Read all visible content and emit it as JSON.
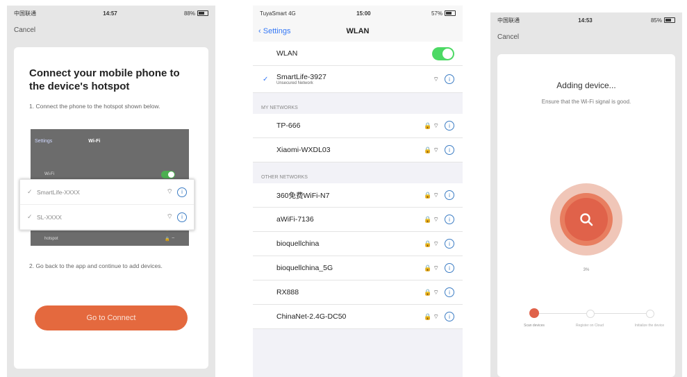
{
  "phone1": {
    "status": {
      "carrier": "中国联通",
      "time": "14:57",
      "battery": "88%"
    },
    "cancel": "Cancel",
    "title": "Connect your mobile phone to the device's hotspot",
    "step1": "1. Connect the phone to the hotspot shown below.",
    "mini": {
      "nav_back": "Settings",
      "nav_title": "Wi-Fi",
      "wifi_label": "Wi-Fi",
      "row_home": "home",
      "row_hotspot": "hotspot"
    },
    "networks": [
      "SmartLife-XXXX",
      "SL-XXXX"
    ],
    "step2": "2. Go back to the app and continue to add devices.",
    "button": "Go to Connect"
  },
  "phone2": {
    "status": {
      "carrier": "TuyaSmart",
      "signal": "4G",
      "time": "15:00",
      "battery": "57%"
    },
    "back": "Settings",
    "title": "WLAN",
    "wlan_label": "WLAN",
    "connected": {
      "name": "SmartLife-3927",
      "sub": "Unsecured Network"
    },
    "my_networks_header": "MY NETWORKS",
    "my_networks": [
      "TP-666",
      "Xiaomi-WXDL03"
    ],
    "other_networks_header": "OTHER NETWORKS",
    "other_networks": [
      "360免费WiFi-N7",
      "aWiFi-7136",
      "bioquellchina",
      "bioquellchina_5G",
      "RX888",
      "ChinaNet-2.4G-DC50"
    ]
  },
  "phone3": {
    "status": {
      "carrier": "中国联通",
      "time": "14:53",
      "battery": "85%"
    },
    "cancel": "Cancel",
    "title": "Adding device...",
    "hint": "Ensure that the Wi-Fi signal is good.",
    "progress": "3%",
    "steps": [
      "Scan devices",
      "Register on Cloud",
      "Initialize the device"
    ]
  },
  "colors": {
    "accent": "#e4693e",
    "toggle_on": "#4cd964",
    "link": "#3478f6"
  }
}
